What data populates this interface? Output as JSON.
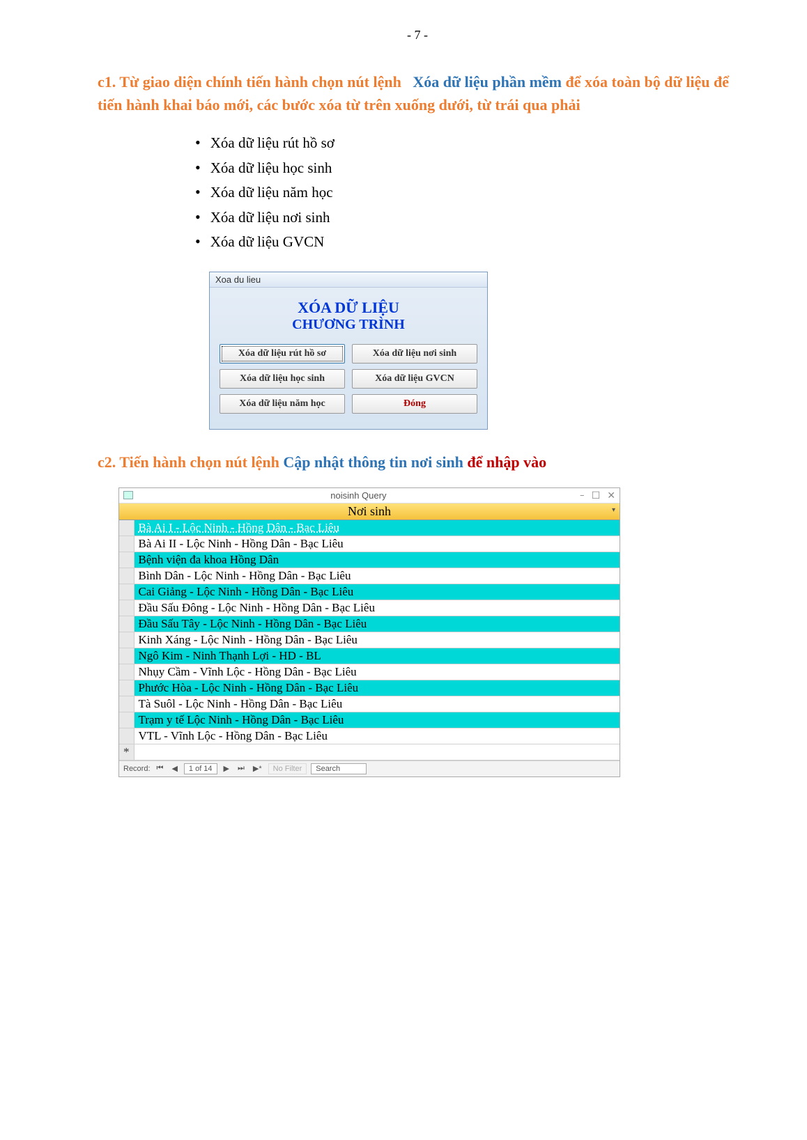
{
  "page_number_text": "- 7 -",
  "heading1": {
    "prefix": "c1. Từ giao diện chính tiến hành chọn nút lệnh",
    "blue": "Xóa dữ liệu phần mềm",
    "suffix": "để xóa toàn bộ dữ liệu để tiến hành khai báo mới, các bước xóa từ trên xuống dưới, từ trái qua phải"
  },
  "bullets": [
    "Xóa dữ liệu rút hồ sơ",
    "Xóa dữ liệu học sinh",
    "Xóa dữ liệu năm học",
    "Xóa dữ liệu nơi sinh",
    "Xóa dữ liệu GVCN"
  ],
  "dialog": {
    "title": "Xoa du lieu",
    "line1": "XÓA DỮ LIỆU",
    "line2": "CHƯƠNG TRÌNH",
    "buttons": {
      "rut_hs": "Xóa dữ liệu rút hồ sơ",
      "noi_sinh": "Xóa dữ liệu nơi sinh",
      "hoc_sinh": "Xóa dữ liệu học sinh",
      "gvcn": "Xóa dữ liệu GVCN",
      "nam_hoc": "Xóa dữ liệu năm học",
      "dong": "Đóng"
    }
  },
  "heading2": {
    "prefix": "c2. Tiến hành chọn nút lệnh",
    "blue": "Cập nhật thông tin nơi sinh",
    "suffix": "để nhập vào"
  },
  "access": {
    "window_title": "noisinh Query",
    "column_header": "Nơi sinh",
    "rows": [
      {
        "text": "Bà Ai I - Lộc Ninh - Hồng Dân - Bạc Liêu",
        "hl": true,
        "sel": true
      },
      {
        "text": "Bà Ai II - Lộc Ninh - Hồng Dân - Bạc Liêu",
        "hl": false
      },
      {
        "text": "Bệnh viện đa khoa Hồng Dân",
        "hl": true
      },
      {
        "text": "Bình Dân - Lộc Ninh - Hồng Dân - Bạc Liêu",
        "hl": false
      },
      {
        "text": "Cai Giảng - Lộc Ninh - Hồng Dân - Bạc Liêu",
        "hl": true
      },
      {
        "text": "Đầu Sấu Đông - Lộc Ninh - Hồng Dân - Bạc Liêu",
        "hl": false
      },
      {
        "text": "Đầu Sấu Tây - Lộc Ninh - Hồng Dân - Bạc Liêu",
        "hl": true
      },
      {
        "text": "Kinh Xáng - Lộc Ninh - Hồng Dân - Bạc Liêu",
        "hl": false
      },
      {
        "text": "Ngô Kim - Ninh Thạnh Lợi - HD - BL",
        "hl": true
      },
      {
        "text": "Nhụy Cầm - Vĩnh Lộc - Hồng Dân - Bạc Liêu",
        "hl": false
      },
      {
        "text": "Phước Hòa - Lộc Ninh - Hồng Dân - Bạc Liêu",
        "hl": true
      },
      {
        "text": "Tà Suôl - Lộc Ninh - Hồng Dân - Bạc Liêu",
        "hl": false
      },
      {
        "text": "Trạm y tế Lộc Ninh - Hồng Dân - Bạc Liêu",
        "hl": true
      },
      {
        "text": "VTL - Vĩnh Lộc - Hồng Dân - Bạc Liêu",
        "hl": false
      }
    ],
    "nav": {
      "label": "Record:",
      "first": "⏮",
      "prev": "◀",
      "counter": "1 of 14",
      "next": "▶",
      "last": "⏭",
      "new": "▶*",
      "filter": "No Filter",
      "search": "Search"
    },
    "win": {
      "min": "−",
      "max": "☐",
      "close": "✕"
    }
  }
}
